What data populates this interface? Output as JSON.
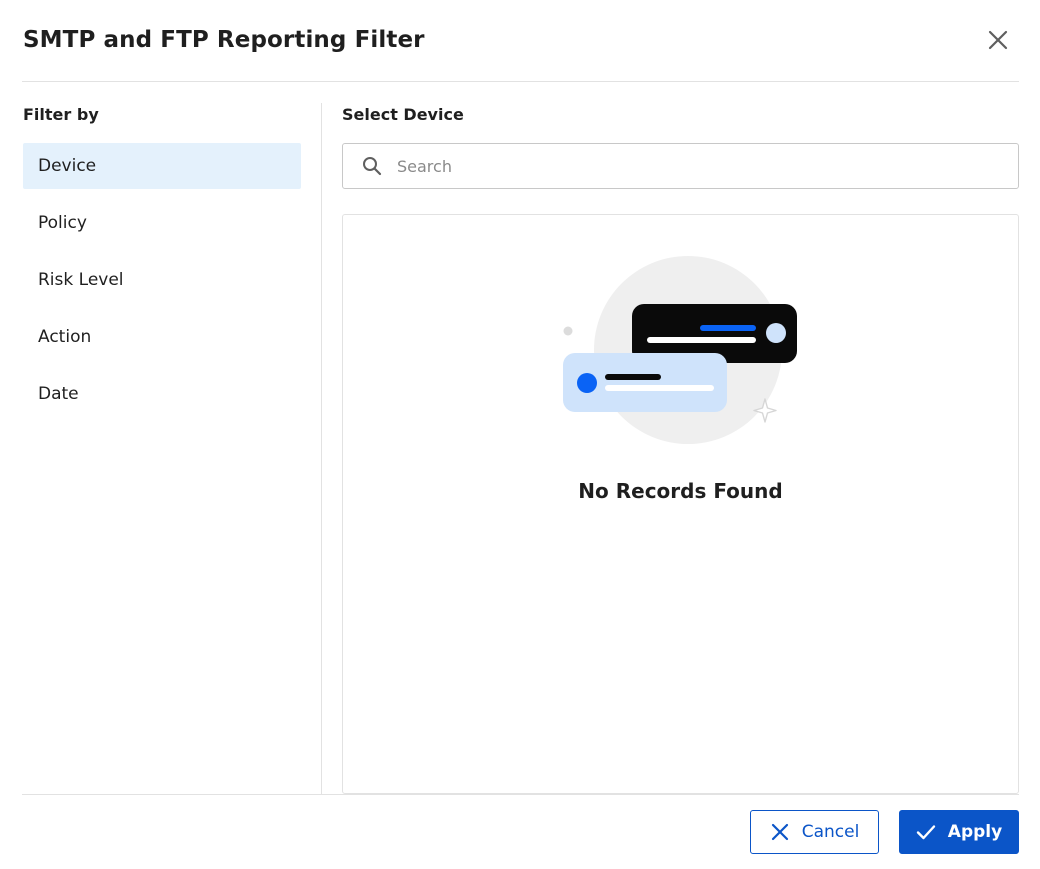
{
  "dialog": {
    "title": "SMTP and FTP Reporting Filter",
    "close_icon": "close-icon"
  },
  "filter": {
    "heading": "Filter by",
    "items": [
      {
        "label": "Device",
        "active": true
      },
      {
        "label": "Policy",
        "active": false
      },
      {
        "label": "Risk Level",
        "active": false
      },
      {
        "label": "Action",
        "active": false
      },
      {
        "label": "Date",
        "active": false
      }
    ]
  },
  "device": {
    "heading": "Select Device",
    "search_placeholder": "Search",
    "search_value": "",
    "search_icon": "search-icon",
    "empty_message": "No Records Found"
  },
  "footer": {
    "cancel_label": "Cancel",
    "cancel_icon": "close-icon",
    "apply_label": "Apply",
    "apply_icon": "check-icon"
  },
  "colors": {
    "accent": "#0b55c8",
    "active_bg": "#e4f1fc",
    "divider": "#e2e2e2",
    "illustration_blue": "#0a63f5",
    "illustration_light_blue": "#cfe3fb",
    "illustration_circle": "#efefef"
  }
}
